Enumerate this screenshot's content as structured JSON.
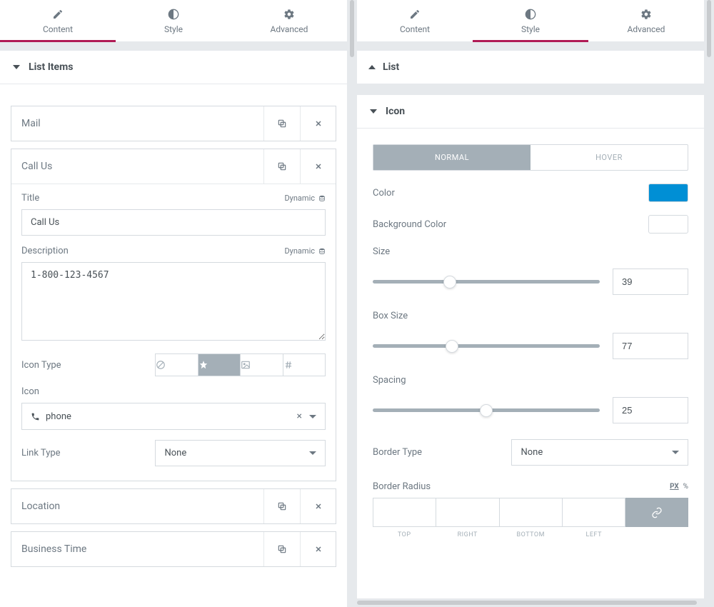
{
  "tabs": {
    "content": "Content",
    "style": "Style",
    "advanced": "Advanced"
  },
  "left": {
    "section_title": "List Items",
    "items": [
      {
        "title": "Mail"
      },
      {
        "title": "Call Us"
      },
      {
        "title": "Location"
      },
      {
        "title": "Business Time"
      }
    ],
    "open_item": {
      "title_label": "Title",
      "title_value": "Call Us",
      "description_label": "Description",
      "description_value": "1-800-123-4567",
      "dynamic_label": "Dynamic",
      "icon_type_label": "Icon Type",
      "icon_label": "Icon",
      "icon_value": "phone",
      "link_type_label": "Link Type",
      "link_type_value": "None"
    }
  },
  "right": {
    "list_section": "List",
    "icon_section": "Icon",
    "state_normal": "NORMAL",
    "state_hover": "HOVER",
    "color_label": "Color",
    "color_value": "#008fd5",
    "bg_color_label": "Background Color",
    "bg_color_value": "#ffffff",
    "size_label": "Size",
    "size_value": "39",
    "box_size_label": "Box Size",
    "box_size_value": "77",
    "spacing_label": "Spacing",
    "spacing_value": "25",
    "border_type_label": "Border Type",
    "border_type_value": "None",
    "border_radius_label": "Border Radius",
    "units_px": "PX",
    "units_pct": "%",
    "dim_top": "TOP",
    "dim_right": "RIGHT",
    "dim_bottom": "BOTTOM",
    "dim_left": "LEFT"
  }
}
